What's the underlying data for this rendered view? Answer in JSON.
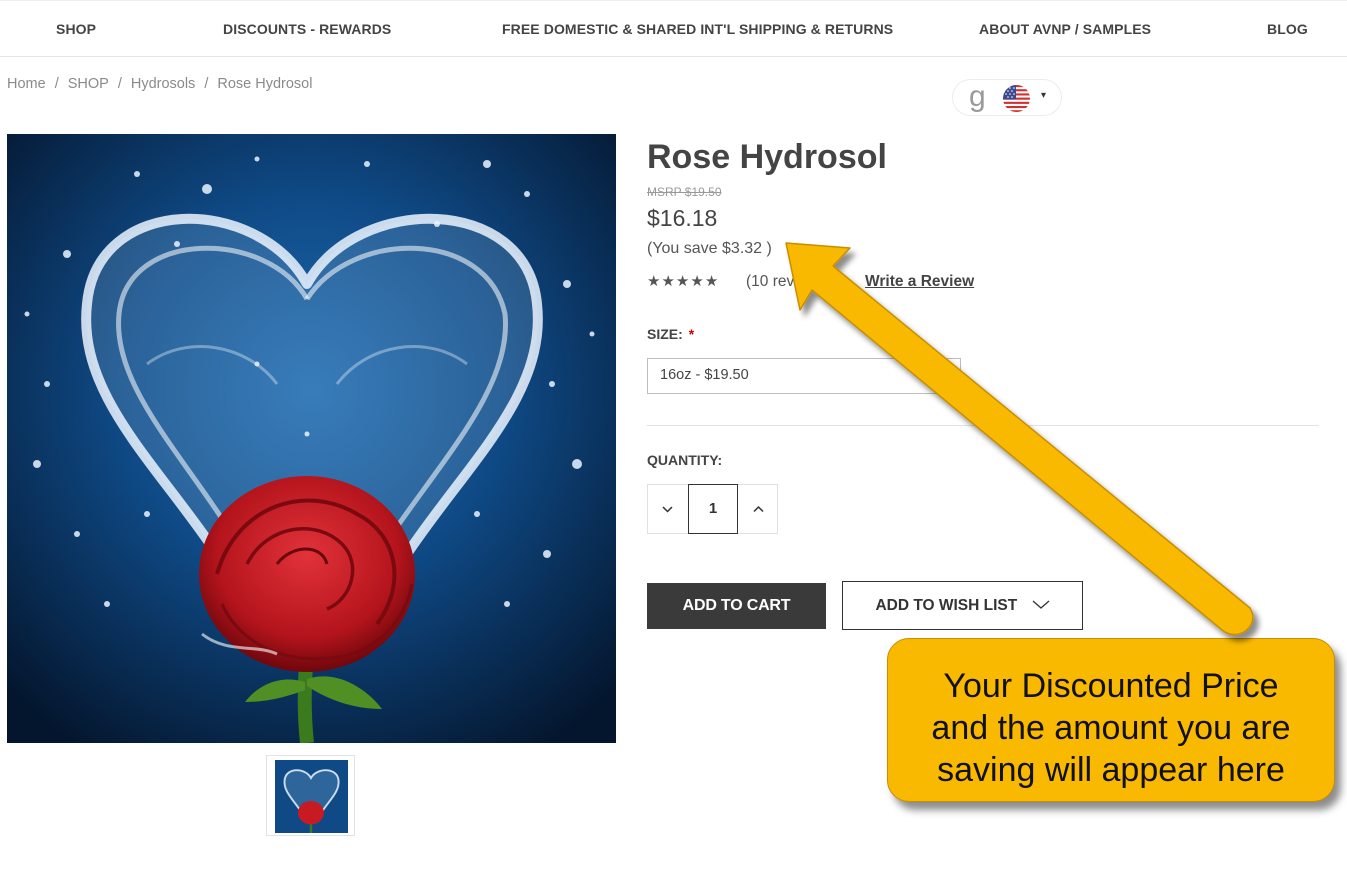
{
  "nav": {
    "shop": "SHOP",
    "discounts": "DISCOUNTS - REWARDS",
    "shipping": "FREE DOMESTIC & SHARED INT'L SHIPPING & RETURNS",
    "about": "ABOUT AVNP / SAMPLES",
    "blog": "BLOG"
  },
  "breadcrumb": [
    "Home",
    "SHOP",
    "Hydrosols",
    "Rose Hydrosol"
  ],
  "breadcrumb_separator": "/",
  "currency": {
    "logo": "g",
    "flag_icon": "us-flag-icon",
    "caret": "▾"
  },
  "product": {
    "title": "Rose Hydrosol",
    "msrp": "MSRP $19.50",
    "price": "$16.18",
    "you_save": "(You save $3.32 )",
    "rating_stars": 5,
    "reviews": "(10 reviews)",
    "write_review": "Write a Review",
    "size_label": "SIZE:",
    "required_mark": "*",
    "size_selected": "16oz - $19.50",
    "quantity_label": "QUANTITY:",
    "quantity": "1",
    "add_to_cart": "ADD TO CART",
    "add_to_wishlist": "ADD TO WISH LIST"
  },
  "callout": {
    "line1": "Your Discounted Price",
    "line2": "and the amount you are",
    "line3": "saving will appear here"
  },
  "colors": {
    "callout_fill": "#f9b900",
    "cart_button": "#3a3a3a",
    "image_bg": "#0e3e72",
    "rose": "#c81a22"
  }
}
